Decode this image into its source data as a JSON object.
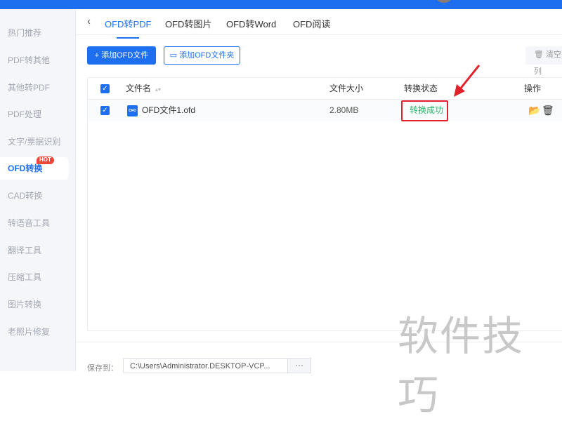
{
  "sidebar": {
    "items": [
      {
        "label": "热门推荐"
      },
      {
        "label": "PDF转其他"
      },
      {
        "label": "其他转PDF"
      },
      {
        "label": "PDF处理"
      },
      {
        "label": "文字/票据识别"
      },
      {
        "label": "OFD转换",
        "badge": "HOT"
      },
      {
        "label": "CAD转换"
      },
      {
        "label": "转语音工具"
      },
      {
        "label": "翻译工具"
      },
      {
        "label": "压缩工具"
      },
      {
        "label": "图片转换"
      },
      {
        "label": "老照片修复"
      }
    ]
  },
  "tabs": [
    {
      "label": "OFD转PDF"
    },
    {
      "label": "OFD转图片"
    },
    {
      "label": "OFD转Word"
    },
    {
      "label": "OFD阅读"
    }
  ],
  "toolbar": {
    "add_file": "添加OFD文件",
    "add_folder": "添加OFD文件夹",
    "clear": "清空列"
  },
  "table": {
    "headers": {
      "name": "文件名",
      "size": "文件大小",
      "status": "转换状态",
      "action": "操作"
    },
    "rows": [
      {
        "name": "OFD文件1.ofd",
        "icon_label": "OFD",
        "size": "2.80MB",
        "status": "转换成功"
      }
    ]
  },
  "footer": {
    "save_label": "保存到：",
    "path": "C:\\Users\\Administrator.DESKTOP-VCP...",
    "more": "···"
  },
  "watermark": "软件技巧",
  "colors": {
    "accent": "#1e6ff0",
    "success": "#2bb46a",
    "highlight": "#e0202a"
  }
}
